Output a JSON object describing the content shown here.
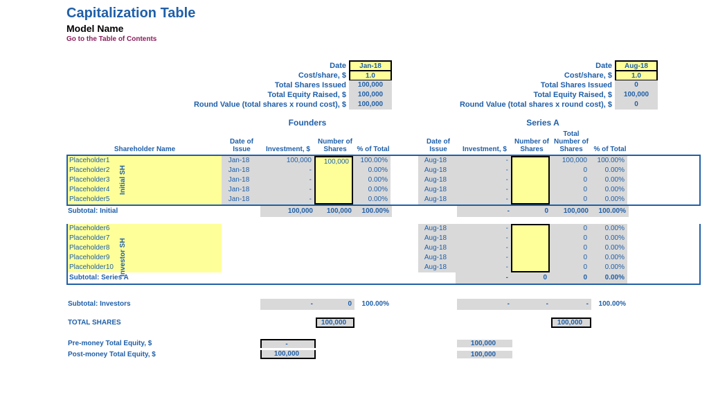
{
  "header": {
    "title": "Capitalization Table",
    "subtitle": "Model Name",
    "toc": "Go to the Table of Contents"
  },
  "founders_summary": {
    "date_label": "Date",
    "date": "Jan-18",
    "cost_label": "Cost/share, $",
    "cost": "1.0",
    "shares_label": "Total Shares Issued",
    "shares": "100,000",
    "equity_label": "Total Equity Raised, $",
    "equity": "100,000",
    "round_label": "Round Value (total shares x round cost), $",
    "round": "100,000"
  },
  "seriesa_summary": {
    "date_label": "Date",
    "date": "Aug-18",
    "cost_label": "Cost/share, $",
    "cost": "1.0",
    "shares_label": "Total Shares Issued",
    "shares": "0",
    "equity_label": "Total Equity Raised, $",
    "equity": "100,000",
    "round_label": "Round Value (total shares x round cost), $",
    "round": "0"
  },
  "sections": {
    "founders": "Founders",
    "seriesa": "Series A"
  },
  "columns": {
    "name": "Shareholder Name",
    "date": "Date of Issue",
    "inv": "Investment, $",
    "shares": "Number of Shares",
    "pct": "% of Total",
    "totshares": "Total Number of Shares"
  },
  "vtabs": {
    "initial": "Initial SH",
    "investor": "Investor SH"
  },
  "initial": [
    {
      "name": "Placeholder1",
      "f_date": "Jan-18",
      "f_inv": "100,000",
      "f_shares": "100,000",
      "f_pct": "100.00%",
      "a_date": "Aug-18",
      "a_inv": "-",
      "a_shares": "",
      "a_tot": "100,000",
      "a_pct": "100.00%"
    },
    {
      "name": "Placeholder2",
      "f_date": "Jan-18",
      "f_inv": "-",
      "f_shares": "",
      "f_pct": "0.00%",
      "a_date": "Aug-18",
      "a_inv": "-",
      "a_shares": "",
      "a_tot": "0",
      "a_pct": "0.00%"
    },
    {
      "name": "Placeholder3",
      "f_date": "Jan-18",
      "f_inv": "-",
      "f_shares": "",
      "f_pct": "0.00%",
      "a_date": "Aug-18",
      "a_inv": "-",
      "a_shares": "",
      "a_tot": "0",
      "a_pct": "0.00%"
    },
    {
      "name": "Placeholder4",
      "f_date": "Jan-18",
      "f_inv": "-",
      "f_shares": "",
      "f_pct": "0.00%",
      "a_date": "Aug-18",
      "a_inv": "-",
      "a_shares": "",
      "a_tot": "0",
      "a_pct": "0.00%"
    },
    {
      "name": "Placeholder5",
      "f_date": "Jan-18",
      "f_inv": "-",
      "f_shares": "",
      "f_pct": "0.00%",
      "a_date": "Aug-18",
      "a_inv": "-",
      "a_shares": "",
      "a_tot": "0",
      "a_pct": "0.00%"
    }
  ],
  "subtotal_initial": {
    "label": "Subtotal: Initial",
    "f_inv": "100,000",
    "f_shares": "100,000",
    "f_pct": "100.00%",
    "a_inv": "-",
    "a_shares": "0",
    "a_tot": "100,000",
    "a_pct": "100.00%"
  },
  "investor": [
    {
      "name": "Placeholder6",
      "a_date": "Aug-18",
      "a_inv": "-",
      "a_shares": "",
      "a_tot": "0",
      "a_pct": "0.00%"
    },
    {
      "name": "Placeholder7",
      "a_date": "Aug-18",
      "a_inv": "-",
      "a_shares": "",
      "a_tot": "0",
      "a_pct": "0.00%"
    },
    {
      "name": "Placeholder8",
      "a_date": "Aug-18",
      "a_inv": "-",
      "a_shares": "",
      "a_tot": "0",
      "a_pct": "0.00%"
    },
    {
      "name": "Placeholder9",
      "a_date": "Aug-18",
      "a_inv": "-",
      "a_shares": "",
      "a_tot": "0",
      "a_pct": "0.00%"
    },
    {
      "name": "Placeholder10",
      "a_date": "Aug-18",
      "a_inv": "-",
      "a_shares": "",
      "a_tot": "0",
      "a_pct": "0.00%"
    }
  ],
  "subtotal_seriesa": {
    "label": "Subtotal: Series A",
    "a_inv": "-",
    "a_shares": "0",
    "a_tot": "0",
    "a_pct": "0.00%"
  },
  "subtotal_investors": {
    "label": "Subtotal: Investors",
    "f_inv": "-",
    "f_shares": "0",
    "f_pct": "100.00%",
    "a_inv": "-",
    "a_shares": "-",
    "a_tot": "-",
    "a_pct": "100.00%"
  },
  "totals": {
    "shares_label": "TOTAL SHARES",
    "f_shares": "100,000",
    "a_tot": "100,000",
    "premoney_label": "Pre-money Total Equity, $",
    "premoney_f": "-",
    "premoney_a": "100,000",
    "postmoney_label": "Post-money Total Equity, $",
    "postmoney_f": "100,000",
    "postmoney_a": "100,000"
  }
}
